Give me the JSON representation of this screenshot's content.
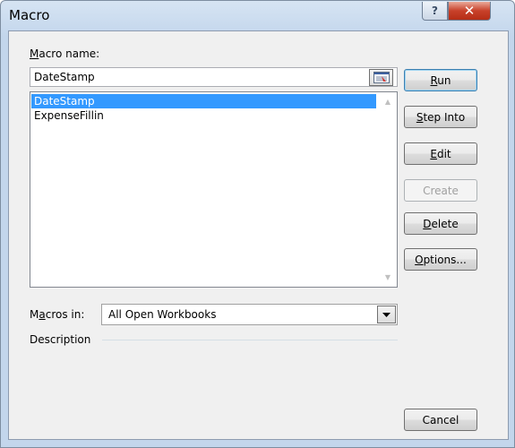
{
  "window": {
    "title": "Macro"
  },
  "titlebar": {
    "help_glyph": "?",
    "close_glyph": "✕"
  },
  "macro_name": {
    "label_prefix": "",
    "label_mnemonic": "M",
    "label_rest": "acro name:",
    "value": "DateStamp"
  },
  "macro_list": {
    "items": [
      "DateStamp",
      "ExpenseFillin"
    ],
    "selected_index": 0
  },
  "macros_in": {
    "label_prefix": "M",
    "label_mnemonic": "a",
    "label_rest": "cros in:",
    "value": "All Open Workbooks"
  },
  "description": {
    "label": "Description"
  },
  "buttons": {
    "run": {
      "mnemonic": "R",
      "rest": "un"
    },
    "step_into": {
      "mnemonic": "S",
      "rest": "tep Into"
    },
    "edit": {
      "mnemonic": "E",
      "rest": "dit"
    },
    "create": {
      "label": "Create"
    },
    "delete": {
      "mnemonic": "D",
      "rest": "elete"
    },
    "options": {
      "mnemonic": "O",
      "rest": "ptions..."
    },
    "cancel": {
      "label": "Cancel"
    }
  },
  "colors": {
    "selection": "#3399ff",
    "close_button": "#c8412a"
  }
}
